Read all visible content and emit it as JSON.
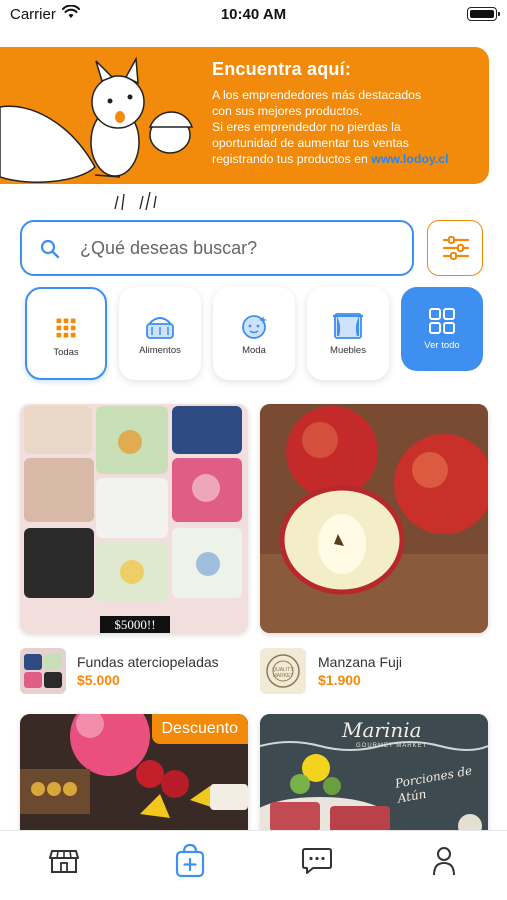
{
  "status_bar": {
    "carrier": "Carrier",
    "time": "10:40 AM"
  },
  "banner": {
    "title": "Encuentra aquí:",
    "line1": "A los emprendedores más destacados",
    "line2": "con sus mejores productos.",
    "line3": "Si eres emprendedor no pierdas la",
    "line4": "oportunidad de aumentar tus ventas",
    "line5": "registrando tus productos en",
    "link": "www.lodoy.cl"
  },
  "search": {
    "placeholder": "¿Qué deseas buscar?"
  },
  "categories": [
    {
      "label": "Todas",
      "icon": "grid-icon"
    },
    {
      "label": "Alimentos",
      "icon": "basket-icon"
    },
    {
      "label": "Moda",
      "icon": "baby-face-icon"
    },
    {
      "label": "Muebles",
      "icon": "curtains-icon"
    },
    {
      "label": "Ver todo",
      "icon": "apps-icon"
    }
  ],
  "products": [
    {
      "name": "Fundas aterciopeladas",
      "price": "$5.000",
      "image_price_tag": "$5000!!"
    },
    {
      "name": "Manzana Fuji",
      "price": "$1.900",
      "seller_badge": "QUALITY MARKET"
    },
    {
      "badge": "Descuento"
    },
    {
      "title_script": "Marinia",
      "subtitle": "GOURMET MARKET",
      "caption": "Porciones de Atún"
    }
  ],
  "tabs": [
    "store-icon",
    "shopping-bag-add-icon",
    "chat-icon",
    "user-icon"
  ],
  "colors": {
    "accent": "#f28a0c",
    "primary": "#3e8ff0"
  }
}
